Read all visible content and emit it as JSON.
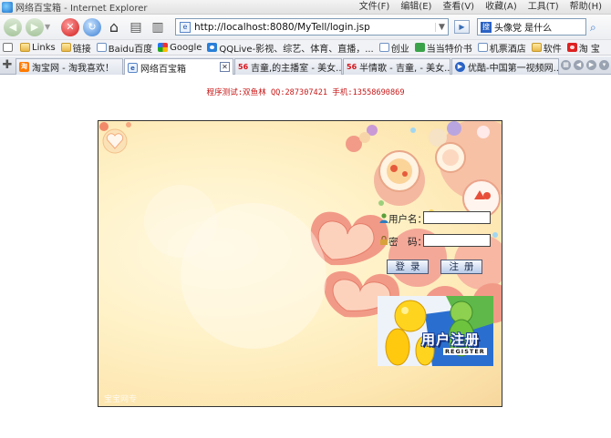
{
  "window": {
    "title": "网络百宝箱 - Internet Explorer",
    "menu": [
      "文件(F)",
      "编辑(E)",
      "查看(V)",
      "收藏(A)",
      "工具(T)",
      "帮助(H)"
    ]
  },
  "navbar": {
    "address": "http://localhost:8080/MyTell/login.jsp",
    "search_value": "头像党 是什么"
  },
  "links": [
    {
      "label": "Links",
      "icon": "folder-icon"
    },
    {
      "label": "链接",
      "icon": "folder-icon"
    },
    {
      "label": "Baidu百度",
      "icon": "page-icon"
    },
    {
      "label": "Google",
      "icon": "google-icon"
    },
    {
      "label": "QQLive-影视、综艺、体育、直播，...",
      "icon": "qq-icon"
    },
    {
      "label": "创业",
      "icon": "page-icon"
    },
    {
      "label": "当当特价书",
      "icon": "dangdang-icon"
    },
    {
      "label": "机票酒店",
      "icon": "page-icon"
    },
    {
      "label": "软件",
      "icon": "folder-icon"
    },
    {
      "label": "淘 宝",
      "icon": "taobao-icon"
    }
  ],
  "tabs": [
    {
      "label": "淘宝网 - 淘我喜欢！",
      "icon": "taobao-icon",
      "active": false
    },
    {
      "label": "网络百宝箱",
      "icon": "page-icon",
      "active": true
    },
    {
      "label": "吉童,的主播室 - 美女...",
      "icon": "56-icon",
      "active": false
    },
    {
      "label": "半情歌 - 吉童, - 美女...",
      "icon": "56-icon",
      "active": false
    },
    {
      "label": "优酷-中国第一视频网...",
      "icon": "youku-icon",
      "active": false
    }
  ],
  "page": {
    "tester_line": "程序测试:双鱼林 QQ:287307421 手机:13558690869",
    "username_label": "用户名：",
    "password_label": "密　码：",
    "login_button": "登录",
    "register_button": "注册",
    "register_banner_title": "用户注册",
    "register_banner_sub": "REGISTER",
    "watermark": "宝宝网专"
  },
  "colors": {
    "tester_text": "#c81818",
    "panel_bg": "#fff2c8",
    "banner_title": "#1c3f95"
  }
}
